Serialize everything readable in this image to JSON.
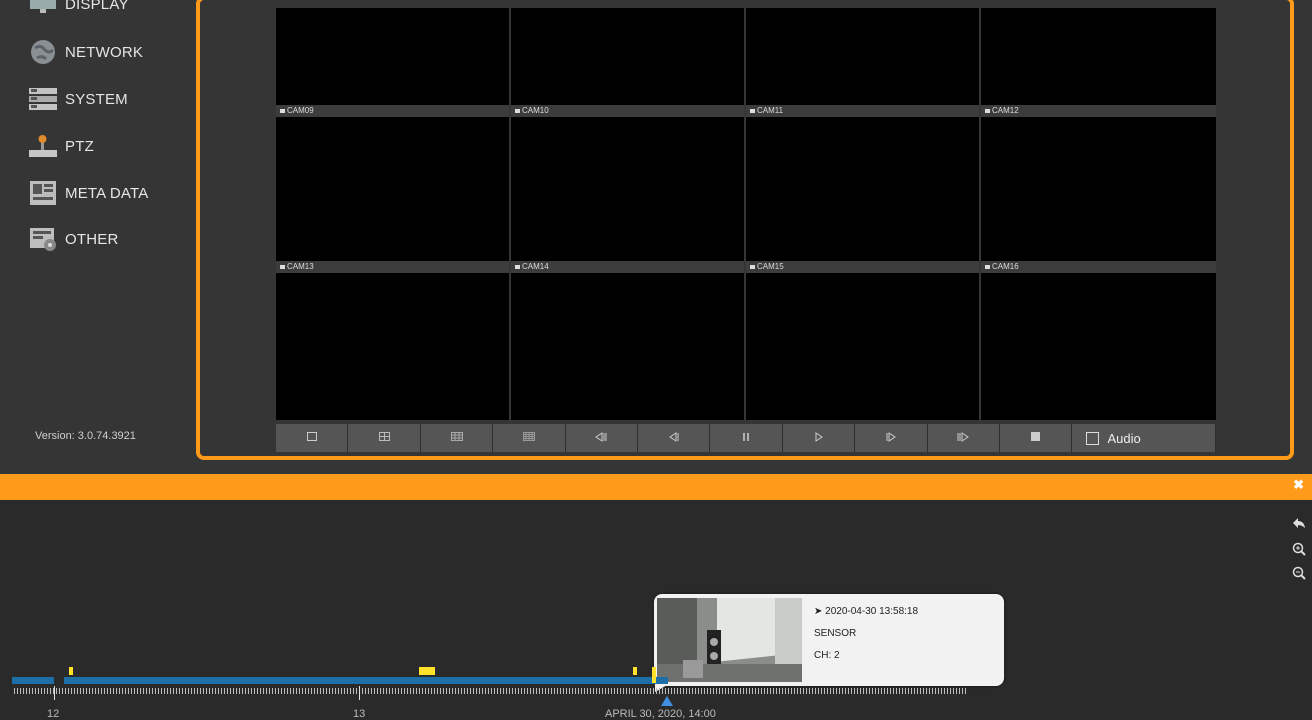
{
  "sidebar": {
    "items": [
      {
        "label": "DISPLAY",
        "icon": "display-icon"
      },
      {
        "label": "NETWORK",
        "icon": "globe-icon"
      },
      {
        "label": "SYSTEM",
        "icon": "server-icon"
      },
      {
        "label": "PTZ",
        "icon": "joystick-icon"
      },
      {
        "label": "META DATA",
        "icon": "metadata-icon"
      },
      {
        "label": "OTHER",
        "icon": "settings-panel-icon"
      }
    ],
    "version": "Version: 3.0.74.3921"
  },
  "cameras": {
    "row1": [
      "CAM09",
      "CAM10",
      "CAM11",
      "CAM12"
    ],
    "row2": [
      "CAM13",
      "CAM14",
      "CAM15",
      "CAM16"
    ]
  },
  "controls": {
    "audio_label": "Audio",
    "buttons": [
      "layout-1-icon",
      "layout-4-icon",
      "layout-9-icon",
      "layout-16-icon",
      "skip-back-icon",
      "step-back-icon",
      "pause-icon",
      "play-icon",
      "step-forward-icon",
      "skip-forward-icon",
      "stop-icon"
    ]
  },
  "timeline": {
    "popup": {
      "datetime": "2020-04-30 13:58:18",
      "event_type": "SENSOR",
      "channel": "CH: 2"
    },
    "labels": {
      "l12": "12",
      "l13": "13",
      "current": "APRIL 30, 2020, 14:00"
    }
  },
  "colors": {
    "accent": "#ff9a1a",
    "track": "#1e6fa8",
    "event": "#ffe22a",
    "cursor": "#3f8fe0"
  }
}
